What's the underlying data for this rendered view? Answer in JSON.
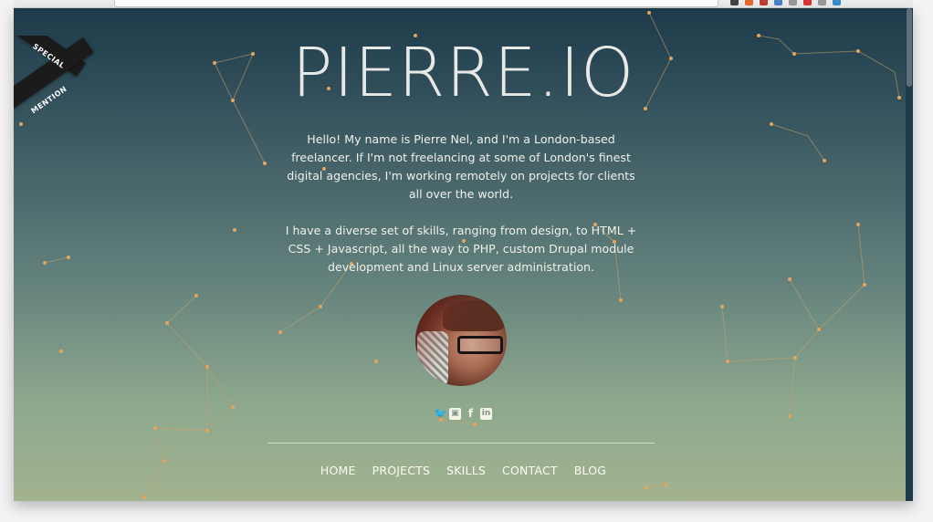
{
  "site": {
    "title": "PIERRE.IO",
    "ribbon_line1": "SPECIAL",
    "ribbon_line2": "MENTION"
  },
  "intro": {
    "paragraph1": "Hello! My name is Pierre Nel, and I'm a London-based freelancer. If I'm not freelancing at some of London's finest digital agencies, I'm working remotely on projects for clients all over the world.",
    "paragraph2": "I have a diverse set of skills, ranging from design, to HTML + CSS + Javascript, all the way to PHP, custom Drupal module development and Linux server administration."
  },
  "social": {
    "icons": [
      "twitter-icon",
      "instagram-icon",
      "facebook-icon",
      "linkedin-icon"
    ],
    "glyphs": [
      "🐦",
      "▣",
      "f",
      "in"
    ]
  },
  "nav": {
    "items": [
      "HOME",
      "PROJECTS",
      "SKILLS",
      "CONTACT",
      "BLOG"
    ]
  },
  "colors": {
    "accent_star": "#e6a55c",
    "gradient_top": "#1d3a4a",
    "gradient_bottom": "#a3b38f"
  }
}
